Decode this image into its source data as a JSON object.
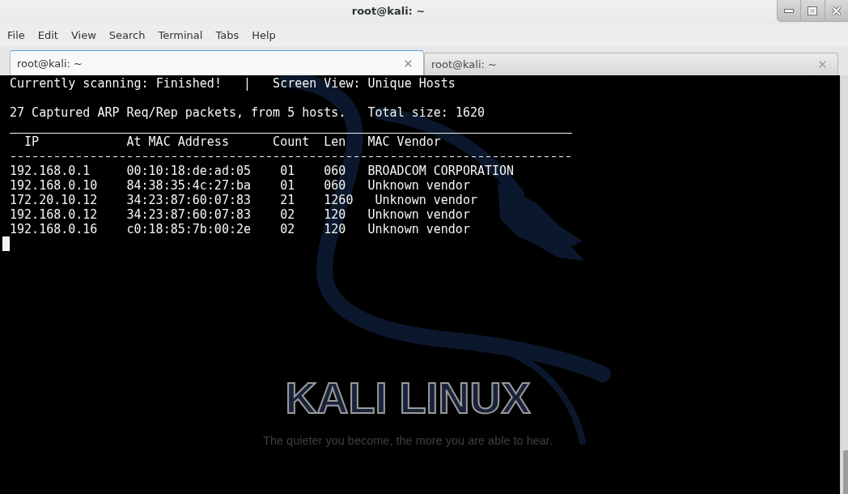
{
  "window": {
    "title": "root@kali: ~"
  },
  "menu": [
    "File",
    "Edit",
    "View",
    "Search",
    "Terminal",
    "Tabs",
    "Help"
  ],
  "tabs": [
    {
      "label": "root@kali: ~",
      "selected": true
    },
    {
      "label": "root@kali: ~",
      "selected": false
    }
  ],
  "terminal": {
    "status_line": "Currently scanning: Finished!   |   Screen View: Unique Hosts",
    "summary_line": "27 Captured ARP Req/Rep packets, from 5 hosts.   Total size: 1620",
    "columns": [
      "IP",
      "At MAC Address",
      "Count",
      "Len",
      "MAC Vendor"
    ],
    "rows": [
      {
        "ip": "192.168.0.1",
        "mac": "00:10:18:de:ad:05",
        "count": "01",
        "len": "060",
        "vendor": "BROADCOM CORPORATION"
      },
      {
        "ip": "192.168.0.10",
        "mac": "84:38:35:4c:27:ba",
        "count": "01",
        "len": "060",
        "vendor": "Unknown vendor"
      },
      {
        "ip": "172.20.10.12",
        "mac": "34:23:87:60:07:83",
        "count": "21",
        "len": "1260",
        "vendor": "Unknown vendor"
      },
      {
        "ip": "192.168.0.12",
        "mac": "34:23:87:60:07:83",
        "count": "02",
        "len": "120",
        "vendor": "Unknown vendor"
      },
      {
        "ip": "192.168.0.16",
        "mac": "c0:18:85:7b:00:2e",
        "count": "02",
        "len": "120",
        "vendor": "Unknown vendor"
      }
    ]
  },
  "wallpaper": {
    "logo": "KALI LINUX",
    "tagline": "The quieter you become, the more you are able to hear."
  }
}
